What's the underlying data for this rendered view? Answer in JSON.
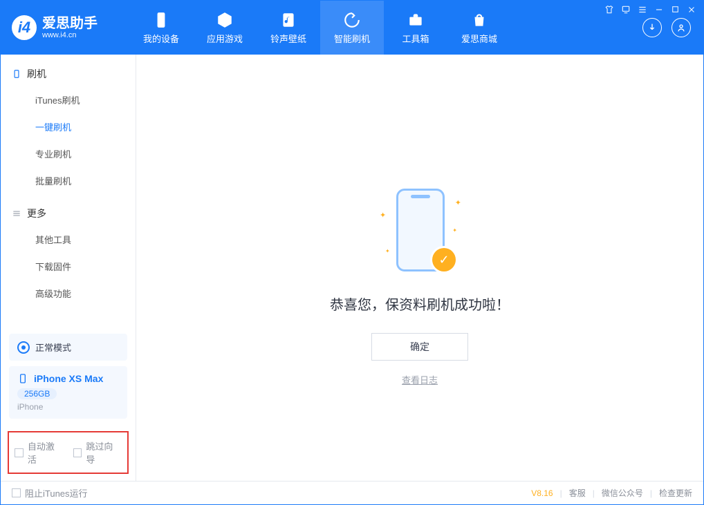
{
  "app": {
    "title": "爱思助手",
    "subtitle": "www.i4.cn"
  },
  "nav": {
    "device": "我的设备",
    "apps": "应用游戏",
    "ringtone": "铃声壁纸",
    "flash": "智能刷机",
    "toolbox": "工具箱",
    "store": "爱思商城"
  },
  "sidebar": {
    "group_flash": "刷机",
    "items_flash": {
      "itunes": "iTunes刷机",
      "oneclick": "一键刷机",
      "pro": "专业刷机",
      "batch": "批量刷机"
    },
    "group_more": "更多",
    "items_more": {
      "other": "其他工具",
      "firmware": "下载固件",
      "advanced": "高级功能"
    }
  },
  "mode": {
    "label": "正常模式"
  },
  "device": {
    "name": "iPhone XS Max",
    "storage": "256GB",
    "type": "iPhone"
  },
  "options": {
    "auto_activate": "自动激活",
    "skip_guide": "跳过向导"
  },
  "main": {
    "success_text": "恭喜您，保资料刷机成功啦！",
    "ok": "确定",
    "view_log": "查看日志"
  },
  "status": {
    "block_itunes": "阻止iTunes运行",
    "version": "V8.16",
    "support": "客服",
    "wechat": "微信公众号",
    "update": "检查更新"
  }
}
